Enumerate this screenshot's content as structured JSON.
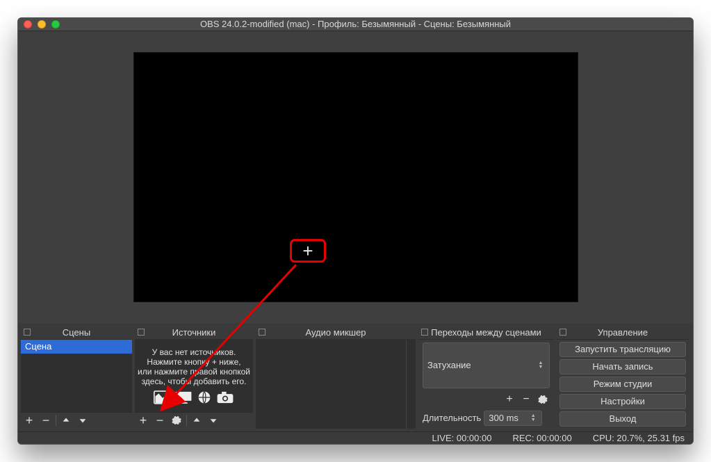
{
  "title": "OBS 24.0.2-modified (mac) - Профиль: Безымянный - Сцены: Безымянный",
  "scenes": {
    "header": "Сцены",
    "items": [
      "Сцена"
    ],
    "selected_index": 0
  },
  "sources": {
    "header": "Источники",
    "empty_l1": "У вас нет источников.",
    "empty_l2": "Нажмите кнопку + ниже,",
    "empty_l3": "или нажмите правой кнопкой",
    "empty_l4": "здесь, чтобы добавить его."
  },
  "mixer": {
    "header": "Аудио микшер"
  },
  "transitions": {
    "header": "Переходы между сценами",
    "current": "Затухание",
    "duration_label": "Длительность",
    "duration_value": "300 ms"
  },
  "controls": {
    "header": "Управление",
    "buttons": [
      "Запустить трансляцию",
      "Начать запись",
      "Режим студии",
      "Настройки",
      "Выход"
    ]
  },
  "status": {
    "live": "LIVE: 00:00:00",
    "rec": "REC: 00:00:00",
    "cpu": "CPU: 20.7%, 25.31 fps"
  },
  "callout_plus": "+"
}
